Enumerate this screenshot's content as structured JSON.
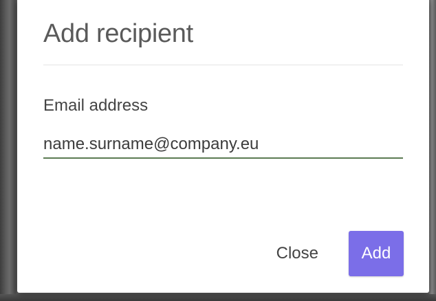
{
  "dialog": {
    "title": "Add recipient",
    "email_field": {
      "label": "Email address",
      "placeholder": "name.surname@company.eu",
      "value": ""
    },
    "actions": {
      "close_label": "Close",
      "add_label": "Add"
    }
  },
  "colors": {
    "accent": "#7b6ee8",
    "input_underline": "#5b7a52",
    "title_text": "#5a5a5a"
  }
}
